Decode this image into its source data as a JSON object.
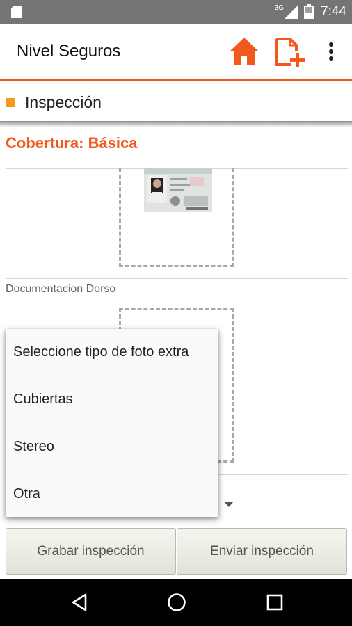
{
  "status_bar": {
    "time": "7:44",
    "network": "3G",
    "icons": [
      "sd-card-icon",
      "signal-icon",
      "battery-icon"
    ]
  },
  "app_bar": {
    "title": "Nivel Seguros",
    "actions": [
      "home-icon",
      "add-page-icon",
      "overflow-menu-icon"
    ]
  },
  "section": {
    "title": "Inspección"
  },
  "coverage": {
    "label": "Cobertura:",
    "value": "Básica"
  },
  "photos": {
    "back_label": "Documentacion Dorso"
  },
  "popup_menu": {
    "items": [
      {
        "label": "Seleccione tipo de foto extra"
      },
      {
        "label": "Cubiertas"
      },
      {
        "label": "Stereo"
      },
      {
        "label": "Otra"
      }
    ]
  },
  "buttons": {
    "save": "Grabar inspección",
    "send": "Enviar inspección"
  },
  "nav_bar": {
    "icons": [
      "back-icon",
      "home-circle-icon",
      "recents-icon"
    ]
  },
  "colors": {
    "accent": "#f15a1c",
    "section_marker": "#f39a1f",
    "status_bar": "#757575",
    "nav_bar": "#000000"
  }
}
